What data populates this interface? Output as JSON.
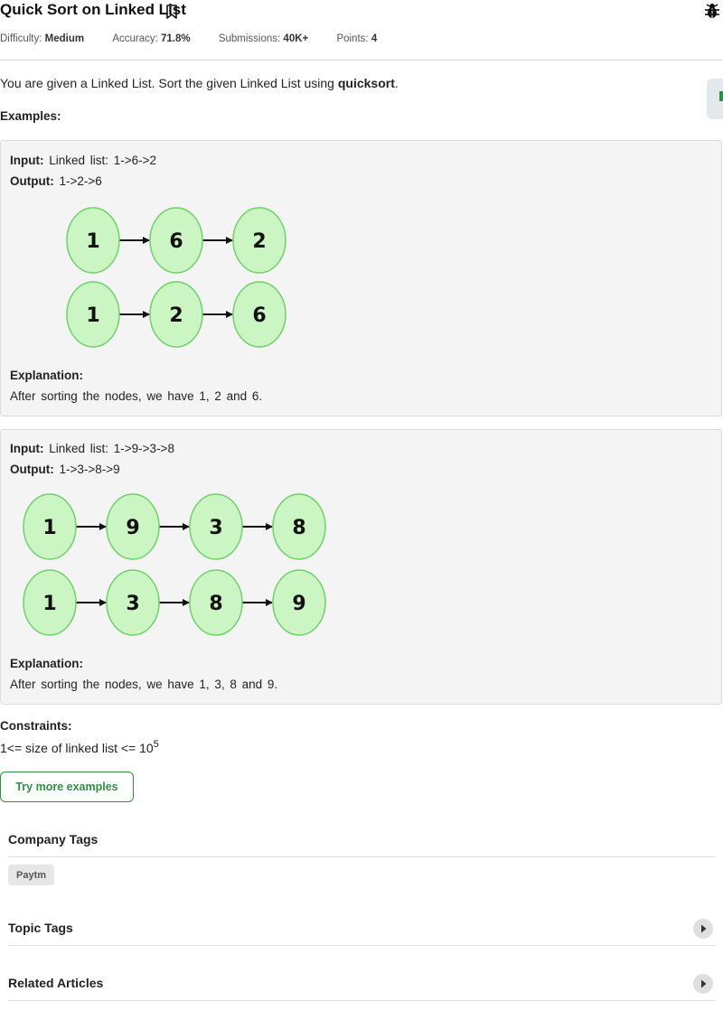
{
  "problem": {
    "title": "Quick Sort on Linked List",
    "meta": [
      {
        "label": "Difficulty:",
        "value": "Medium"
      },
      {
        "label": "Accuracy:",
        "value": "71.8%"
      },
      {
        "label": "Submissions:",
        "value": "40K+"
      },
      {
        "label": "Points:",
        "value": "4"
      }
    ],
    "description_prefix": "You are given a Linked List. Sort the given Linked List using ",
    "description_bold": "quicksort",
    "description_suffix": ".",
    "examples_label": "Examples:"
  },
  "examples": [
    {
      "input_label": "Input:",
      "input_value": "Linked list: 1->6->2",
      "output_label": "Output:",
      "output_value": "1->2->6",
      "diagram": {
        "before": [
          "1",
          "6",
          "2"
        ],
        "after": [
          "1",
          "2",
          "6"
        ]
      },
      "explanation_label": "Explanation:",
      "explanation_text": "After sorting the nodes, we have 1, 2 and 6."
    },
    {
      "input_label": "Input:",
      "input_value": "Linked list: 1->9->3->8",
      "output_label": "Output:",
      "output_value": "1->3->8->9",
      "diagram": {
        "before": [
          "1",
          "9",
          "3",
          "8"
        ],
        "after": [
          "1",
          "3",
          "8",
          "9"
        ]
      },
      "explanation_label": "Explanation:",
      "explanation_text": "After sorting the nodes, we have 1, 3, 8 and 9."
    }
  ],
  "constraints": {
    "label": "Constraints:",
    "text": "1<= size of linked list <= 10",
    "exponent": "5"
  },
  "try_more_button": "Try more examples",
  "company_tags": {
    "title": "Company Tags",
    "tags": [
      "Paytm"
    ]
  },
  "topic_tags": {
    "title": "Topic Tags"
  },
  "related_articles": {
    "title": "Related Articles"
  },
  "colors": {
    "accent": "#2f8d46",
    "node_fill": "#ccf5c4",
    "node_stroke": "#6fcf6a"
  },
  "icons": {
    "bookmark": "bookmark-icon",
    "bug": "bug-icon",
    "expand": "caret-right-icon"
  }
}
